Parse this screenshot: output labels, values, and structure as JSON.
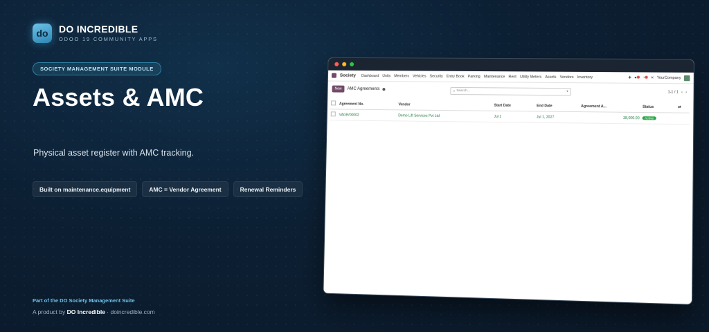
{
  "brand": {
    "logo_text": "do",
    "name": "DO INCREDIBLE",
    "sub": "ODOO 19 COMMUNITY APPS"
  },
  "module_pill": "SOCIETY MANAGEMENT SUITE MODULE",
  "title": "Assets & AMC",
  "subtitle": "Physical asset register with AMC tracking.",
  "chips": [
    "Built on maintenance.equipment",
    "AMC = Vendor Agreement",
    "Renewal Reminders"
  ],
  "footer": {
    "suite": "Part of the DO Society Management Suite",
    "product_prefix": "A product by",
    "product_brand": "DO Incredible",
    "product_suffix": "· doincredible.com"
  },
  "app": {
    "name": "Society",
    "menu": [
      "Dashboard",
      "Units",
      "Members",
      "Vehicles",
      "Security",
      "Entry Book",
      "Parking",
      "Maintenance",
      "Rent",
      "Utility Meters",
      "Assets",
      "Vendors",
      "Inventory"
    ],
    "company": "YourCompany",
    "new_label": "New",
    "view_title": "AMC Agreements",
    "search_placeholder": "Search...",
    "pager": "1-1 / 1",
    "table": {
      "headers": [
        "Agreement No.",
        "Vendor",
        "Start Date",
        "End Date",
        "Agreement A...",
        "Status"
      ],
      "rows": [
        [
          "VAGR/00002",
          "Demo Lift Services Pvt Ltd",
          "Jul 1",
          "Jul 1, 2027",
          "38,000.00",
          "Active"
        ]
      ]
    }
  },
  "colors": {
    "accent": "#6ec3e8",
    "odoo_purple": "#714b67",
    "status_active": "#28a745"
  }
}
